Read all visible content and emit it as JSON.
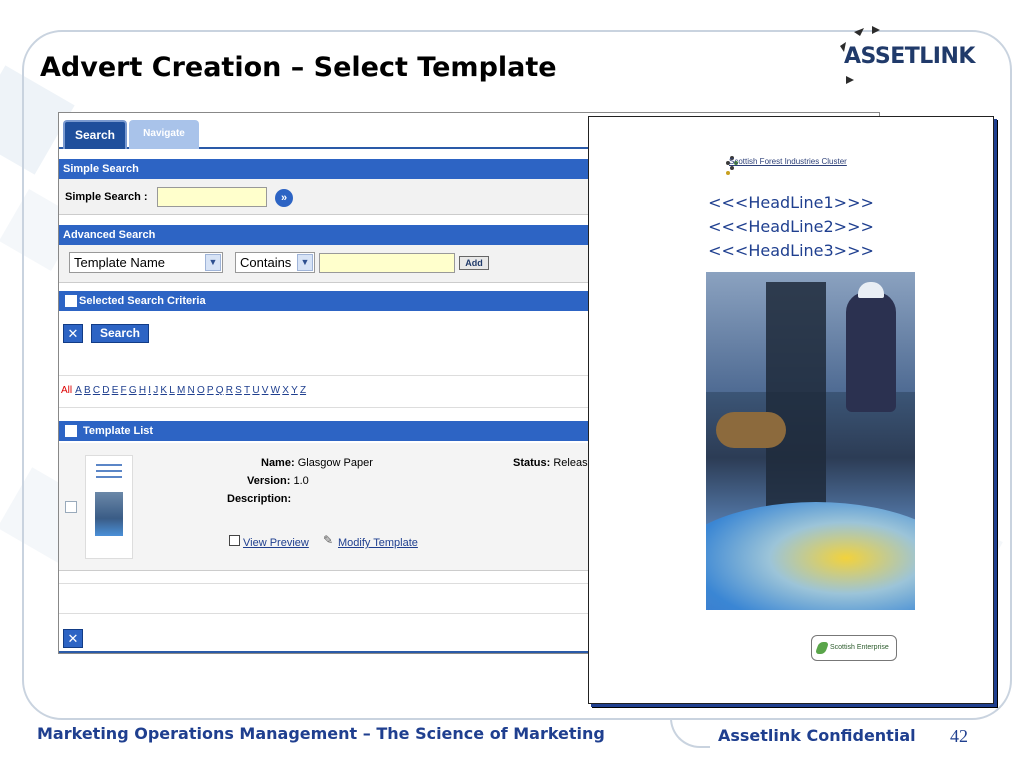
{
  "slide": {
    "title": "Advert Creation – Select Template",
    "footer_left": "Marketing Operations Management  –  The Science of Marketing",
    "footer_right": "Assetlink Confidential",
    "page_number": "42"
  },
  "logo": {
    "text": "ASSETLINK"
  },
  "app": {
    "tabs": [
      {
        "label": "Search",
        "active": true
      },
      {
        "label": "Navigate",
        "active": false
      }
    ],
    "simple_search": {
      "header": "Simple Search",
      "label": "Simple Search :",
      "value": "",
      "go_icon": "double-chevron-right-icon"
    },
    "advanced_search": {
      "header": "Advanced Search",
      "field_select": "Template Name",
      "operator_select": "Contains",
      "value": "",
      "add_label": "Add"
    },
    "selected_criteria": {
      "header": "Selected Search Criteria",
      "search_button": "Search"
    },
    "alphabet": {
      "all": "All",
      "letters": [
        "A",
        "B",
        "C",
        "D",
        "E",
        "F",
        "G",
        "H",
        "I",
        "J",
        "K",
        "L",
        "M",
        "N",
        "O",
        "P",
        "Q",
        "R",
        "S",
        "T",
        "U",
        "V",
        "W",
        "X",
        "Y",
        "Z"
      ]
    },
    "template_list": {
      "header": "Template List",
      "item": {
        "name_label": "Name:",
        "name": "Glasgow Paper",
        "version_label": "Version:",
        "version": "1.0",
        "description_label": "Description:",
        "status_label": "Status:",
        "status": "Releas",
        "view_preview": "View Preview",
        "modify_template": "Modify Template"
      }
    },
    "colors": {
      "bar": "#2d64c4",
      "input": "#ffffcc"
    }
  },
  "preview": {
    "brand": "Scottish Forest Industries Cluster",
    "headlines": [
      "<<<HeadLine1>>>",
      "<<<HeadLine2>>>",
      "<<<HeadLine3>>>"
    ],
    "badge": "Scottish Enterprise"
  }
}
